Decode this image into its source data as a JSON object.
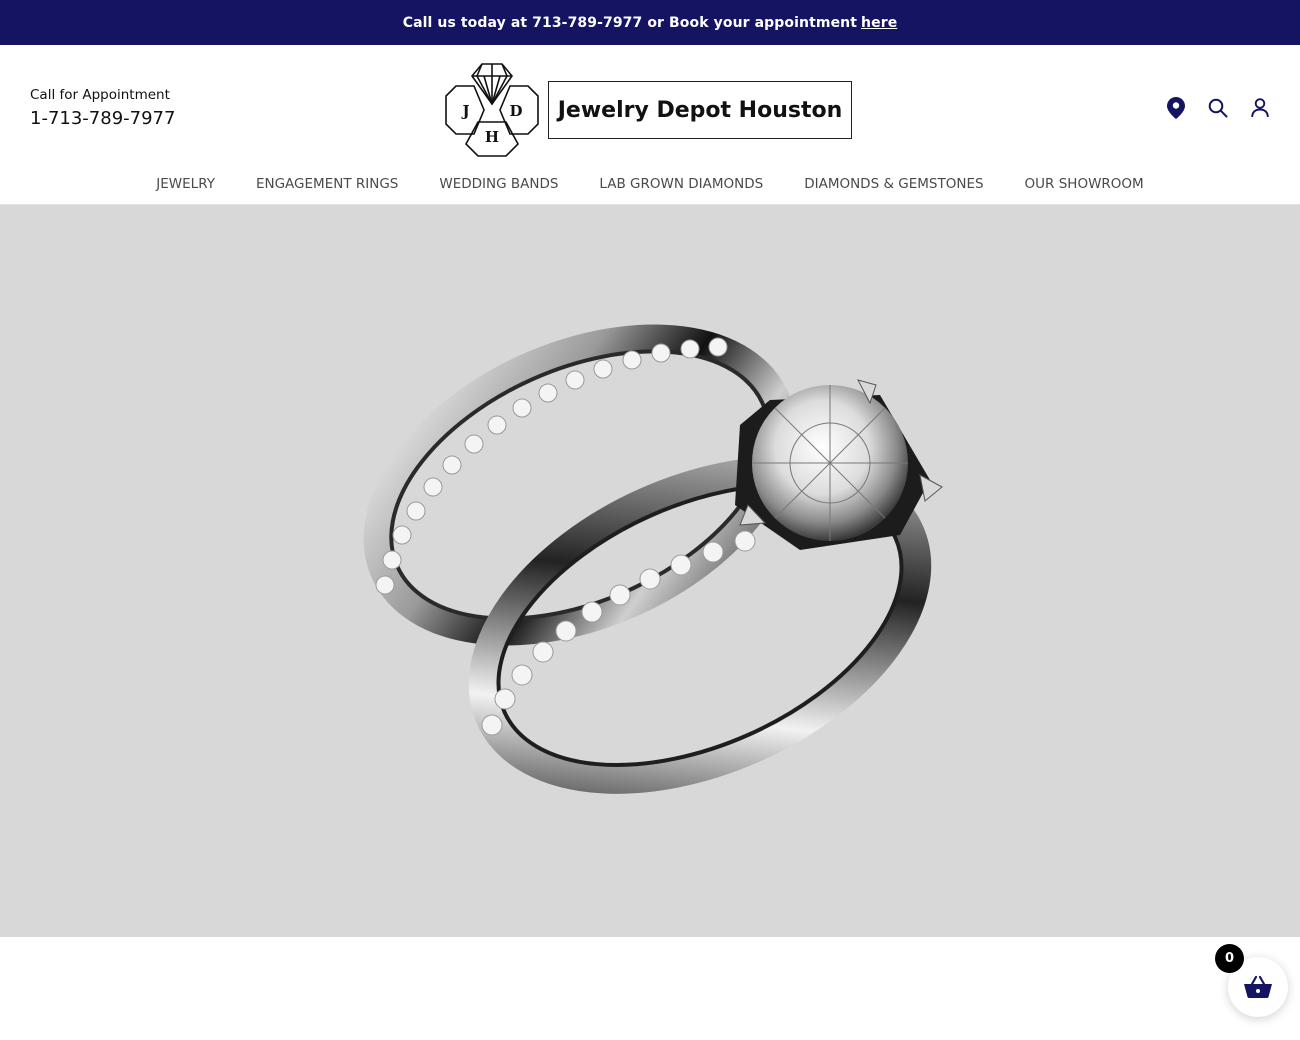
{
  "announcement": {
    "text": "Call us today at 713-789-7977 or Book your appointment",
    "link_label": "here"
  },
  "appointment": {
    "label": "Call for Appointment",
    "phone": "1-713-789-7977"
  },
  "logo": {
    "name": "Jewelry Depot Houston",
    "monogram": [
      "J",
      "D",
      "H"
    ]
  },
  "header_icons": [
    "location-pin-icon",
    "search-icon",
    "user-account-icon"
  ],
  "nav": {
    "items": [
      {
        "label": "JEWELRY"
      },
      {
        "label": "ENGAGEMENT RINGS"
      },
      {
        "label": "WEDDING BANDS"
      },
      {
        "label": "LAB GROWN DIAMONDS"
      },
      {
        "label": "DIAMONDS & GEMSTONES"
      },
      {
        "label": "OUR SHOWROOM"
      }
    ]
  },
  "hero": {
    "image": "diamond-engagement-ring-and-wedding-band"
  },
  "cart": {
    "count": "0",
    "icon": "basket-icon"
  },
  "colors": {
    "brand_navy": "#141463",
    "hero_bg": "#d8d8d8",
    "nav_text": "#4a4a4a"
  }
}
